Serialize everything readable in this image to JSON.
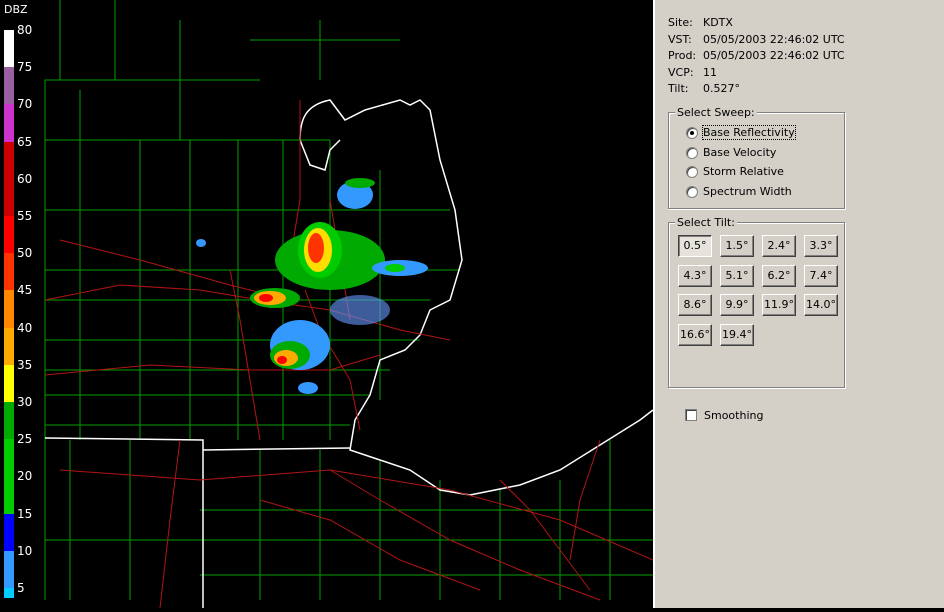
{
  "legend": {
    "title": "DBZ",
    "ticks": [
      "80",
      "75",
      "70",
      "65",
      "60",
      "55",
      "50",
      "45",
      "40",
      "35",
      "30",
      "25",
      "20",
      "15",
      "10",
      "5"
    ],
    "colors": [
      "#ffffff",
      "#9a5fa0",
      "#cc33cc",
      "#cc0000",
      "#cc0000",
      "#ff0000",
      "#ff3300",
      "#ff8800",
      "#ffaa00",
      "#ffff00",
      "#00aa00",
      "#00cc00",
      "#00cc00",
      "#0000ff",
      "#3399ff",
      "#00ccff"
    ]
  },
  "info": {
    "site_label": "Site:",
    "site": "KDTX",
    "vst_label": "VST:",
    "vst": "05/05/2003  22:46:02 UTC",
    "prod_label": "Prod:",
    "prod": "05/05/2003  22:46:02 UTC",
    "vcp_label": "VCP:",
    "vcp": "11",
    "tilt_label": "Tilt:",
    "tilt": "0.527°"
  },
  "sweep": {
    "title": "Select Sweep:",
    "options": [
      "Base Reflectivity",
      "Base Velocity",
      "Storm Relative",
      "Spectrum Width"
    ],
    "selected": "Base Reflectivity"
  },
  "tilt_select": {
    "title": "Select Tilt:",
    "buttons": [
      "0.5°",
      "1.5°",
      "2.4°",
      "3.3°",
      "4.3°",
      "5.1°",
      "6.2°",
      "7.4°",
      "8.6°",
      "9.9°",
      "11.9°",
      "14.0°",
      "16.6°",
      "19.4°"
    ],
    "selected": "0.5°"
  },
  "smoothing": {
    "label": "Smoothing",
    "checked": false
  },
  "colors": {
    "county_lines": "#00aa00",
    "roads": "#aa1111",
    "coast": "#ffffff",
    "panel": "#d4d0c8"
  }
}
